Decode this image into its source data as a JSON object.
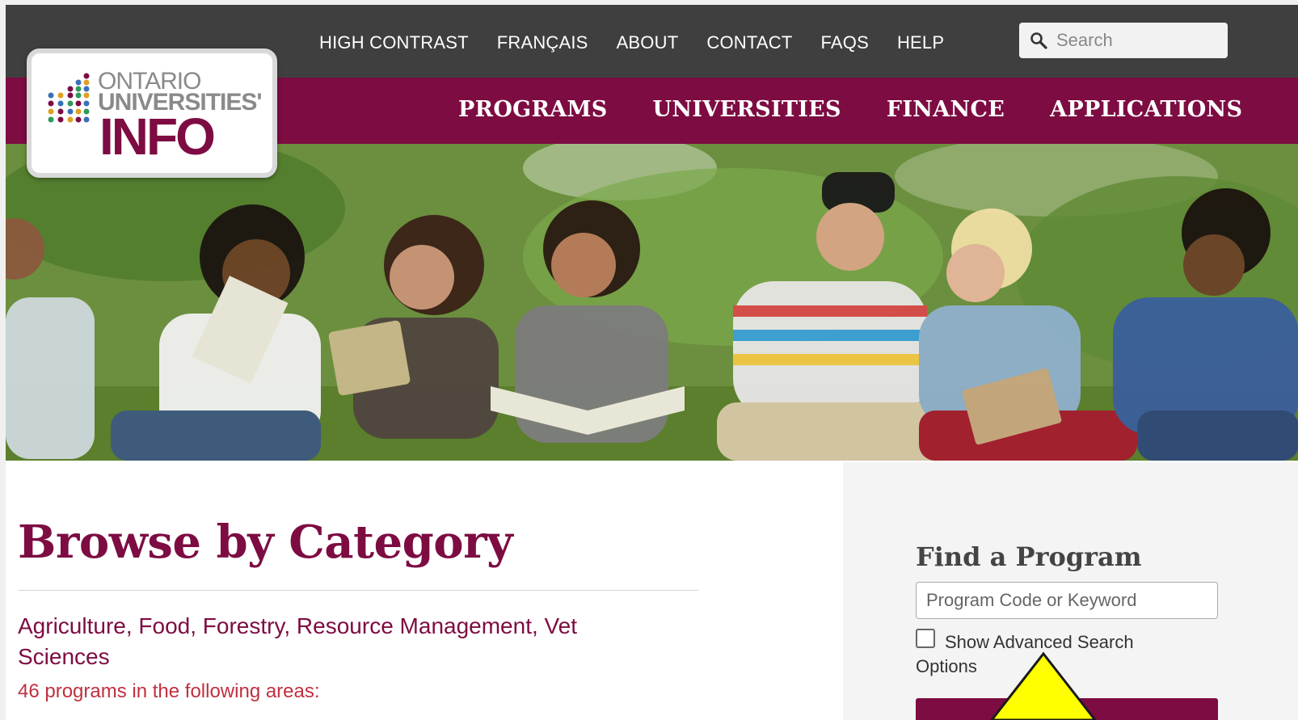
{
  "utility_nav": {
    "links": [
      "HIGH CONTRAST",
      "FRANÇAIS",
      "ABOUT",
      "CONTACT",
      "FAQS",
      "HELP"
    ],
    "search_placeholder": "Search"
  },
  "logo": {
    "line1": "ONTARIO",
    "line2": "UNIVERSITIES'",
    "line3": "INFO"
  },
  "main_nav": {
    "links": [
      "PROGRAMS",
      "UNIVERSITIES",
      "FINANCE",
      "APPLICATIONS"
    ]
  },
  "colors": {
    "brand": "#7d0c42",
    "utility_bar": "#3f3f3f",
    "count_text": "#c0303f",
    "annotation_yellow": "#ffff00"
  },
  "browse": {
    "title": "Browse by Category",
    "category": "Agriculture, Food, Forestry, Resource Management, Vet Sciences",
    "count_text": "46 programs in the following areas:"
  },
  "find_program": {
    "title": "Find a Program",
    "input_placeholder": "Program Code or Keyword",
    "advanced_label": "Show Advanced Search Options"
  }
}
